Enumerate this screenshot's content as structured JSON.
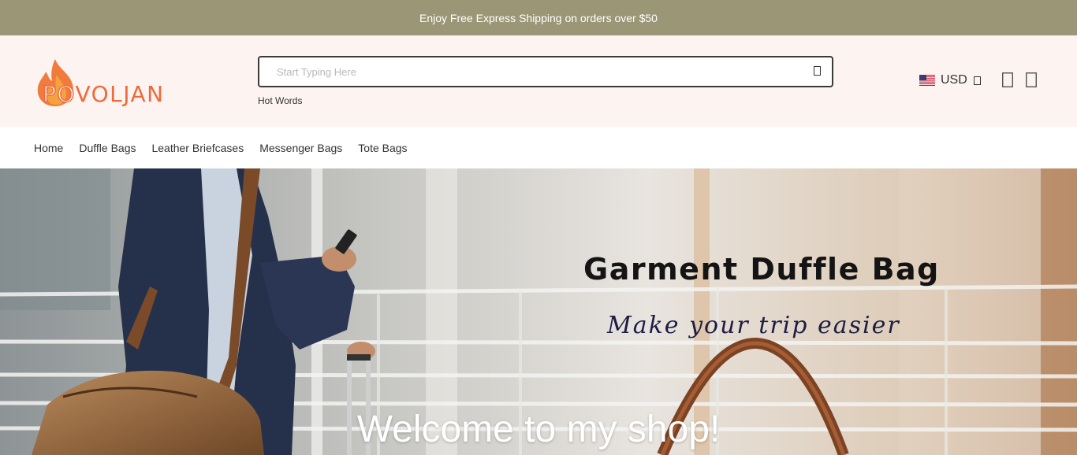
{
  "announcement": {
    "text": "Enjoy Free Express Shipping on orders over $50"
  },
  "header": {
    "logo_prefix": "PO",
    "logo_suffix": "VOLJAN",
    "search": {
      "placeholder": "Start Typing Here",
      "value": ""
    },
    "hot_words_label": "Hot Words",
    "currency": {
      "code": "USD",
      "flag_icon": "us-flag-icon"
    },
    "icons": [
      "search-icon",
      "chevron-down-icon",
      "account-icon",
      "cart-icon"
    ]
  },
  "nav": {
    "items": [
      {
        "label": "Home"
      },
      {
        "label": "Duffle Bags"
      },
      {
        "label": "Leather Briefcases"
      },
      {
        "label": "Messenger Bags"
      },
      {
        "label": "Tote Bags"
      }
    ]
  },
  "hero": {
    "title": "Garment Duffle Bag",
    "subtitle": "Make your trip easier",
    "welcome": "Welcome to my shop!"
  },
  "colors": {
    "announcement_bg": "#9b9676",
    "header_bg": "#fdf4f2",
    "brand_orange": "#ee6a3b"
  }
}
